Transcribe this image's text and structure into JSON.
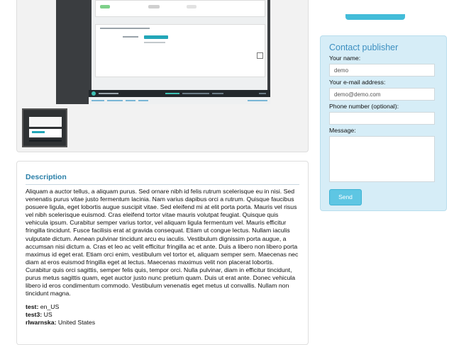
{
  "gallery": {
    "main_image_alt": "Screenshot",
    "thumbnails": 1
  },
  "description": {
    "title": "Description",
    "body": "Aliquam a auctor tellus, a aliquam purus. Sed ornare nibh id felis rutrum scelerisque eu in nisi. Sed venenatis purus vitae justo fermentum lacinia. Nam varius dapibus orci a rutrum. Quisque faucibus posuere ligula, eget lobortis augue suscipit vitae. Sed eleifend mi at elit porta porta. Mauris vel risus vel nibh scelerisque euismod. Cras eleifend tortor vitae mauris volutpat feugiat. Quisque quis vehicula ipsum. Curabitur semper varius tortor, vel aliquam ligula fermentum vel. Mauris efficitur fringilla tincidunt. Fusce facilisis erat at gravida consequat. Etiam ut congue lectus. Nullam iaculis vulputate dictum. Aenean pulvinar tincidunt arcu eu iaculis. Vestibulum dignissim porta augue, a accumsan nisi dictum a. Cras et leo ac velit efficitur fringilla ac et ante. Duis a libero non libero porta maximus id eget erat. Etiam orci enim, vestibulum vel tortor et, aliquam semper sem. Maecenas nec diam at eros euismod fringilla eget at lectus. Maecenas maximus velit non placerat lobortis. Curabitur quis orci sagittis, semper felis quis, tempor orci. Nulla pulvinar, diam in efficitur tincidunt, purus metus sagittis quam, eget auctor justo nunc pretium quam. Duis ut erat ante. Donec vehicula libero id eros condimentum commodo. Vestibulum venenatis eget metus ut convallis. Nullam non tincidunt magna.",
    "attributes": [
      {
        "key": "test:",
        "value": " en_US"
      },
      {
        "key": "test3:",
        "value": " US"
      },
      {
        "key": "rlwarnska:",
        "value": " United States"
      }
    ]
  },
  "contact": {
    "title": "Contact publisher",
    "name_label": "Your name:",
    "name_value": "demo",
    "email_label": "Your e-mail address:",
    "email_value": "demo@demo.com",
    "phone_label": "Phone number (optional):",
    "phone_value": "",
    "message_label": "Message:",
    "message_value": "",
    "send_label": "Send"
  },
  "colors": {
    "accent": "#2a7fa8",
    "contact_bg": "#d6edf7",
    "send_button": "#5ec6e3"
  }
}
